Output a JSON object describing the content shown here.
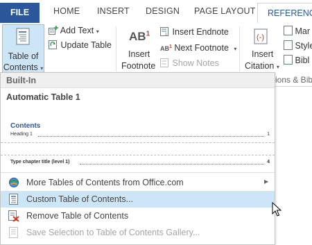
{
  "tabs": {
    "file": "FILE",
    "home": "HOME",
    "insert": "INSERT",
    "design": "DESIGN",
    "page_layout": "PAGE LAYOUT",
    "references": "REFERENCES"
  },
  "ribbon": {
    "toc_line1": "Table of",
    "toc_line2": "Contents",
    "add_text": "Add Text",
    "update_table": "Update Table",
    "insert_footnote_line1": "Insert",
    "insert_footnote_line2": "Footnote",
    "ab_label": "AB",
    "ab_superscript": "1",
    "insert_endnote": "Insert Endnote",
    "next_footnote": "Next Footnote",
    "show_notes": "Show Notes",
    "insert_citation_line1": "Insert",
    "insert_citation_line2": "Citation",
    "manage": "Mar",
    "style": "Style",
    "biblio": "Bibl",
    "group_label_partial": "ions & Bib"
  },
  "dropdown": {
    "section_header": "Built-In",
    "gallery_item_title": "Automatic Table 1",
    "preview_heading": "Contents",
    "preview_heading1": "Heading 1",
    "preview_heading1_page": "1",
    "preview2_entry": "Type chapter title (level 1)",
    "preview2_page": "4",
    "menu": [
      {
        "label": "More Tables of Contents from Office.com",
        "icon": "office-globe-icon"
      },
      {
        "label": "Custom Table of Contents...",
        "icon": "toc-document-icon"
      },
      {
        "label": "Remove Table of Contents",
        "icon": "remove-toc-icon"
      },
      {
        "label": "Save Selection to Table of Contents Gallery...",
        "icon": "save-selection-icon"
      }
    ]
  },
  "colors": {
    "file_tab": "#2b579a",
    "hover_highlight": "#cde6f7"
  }
}
